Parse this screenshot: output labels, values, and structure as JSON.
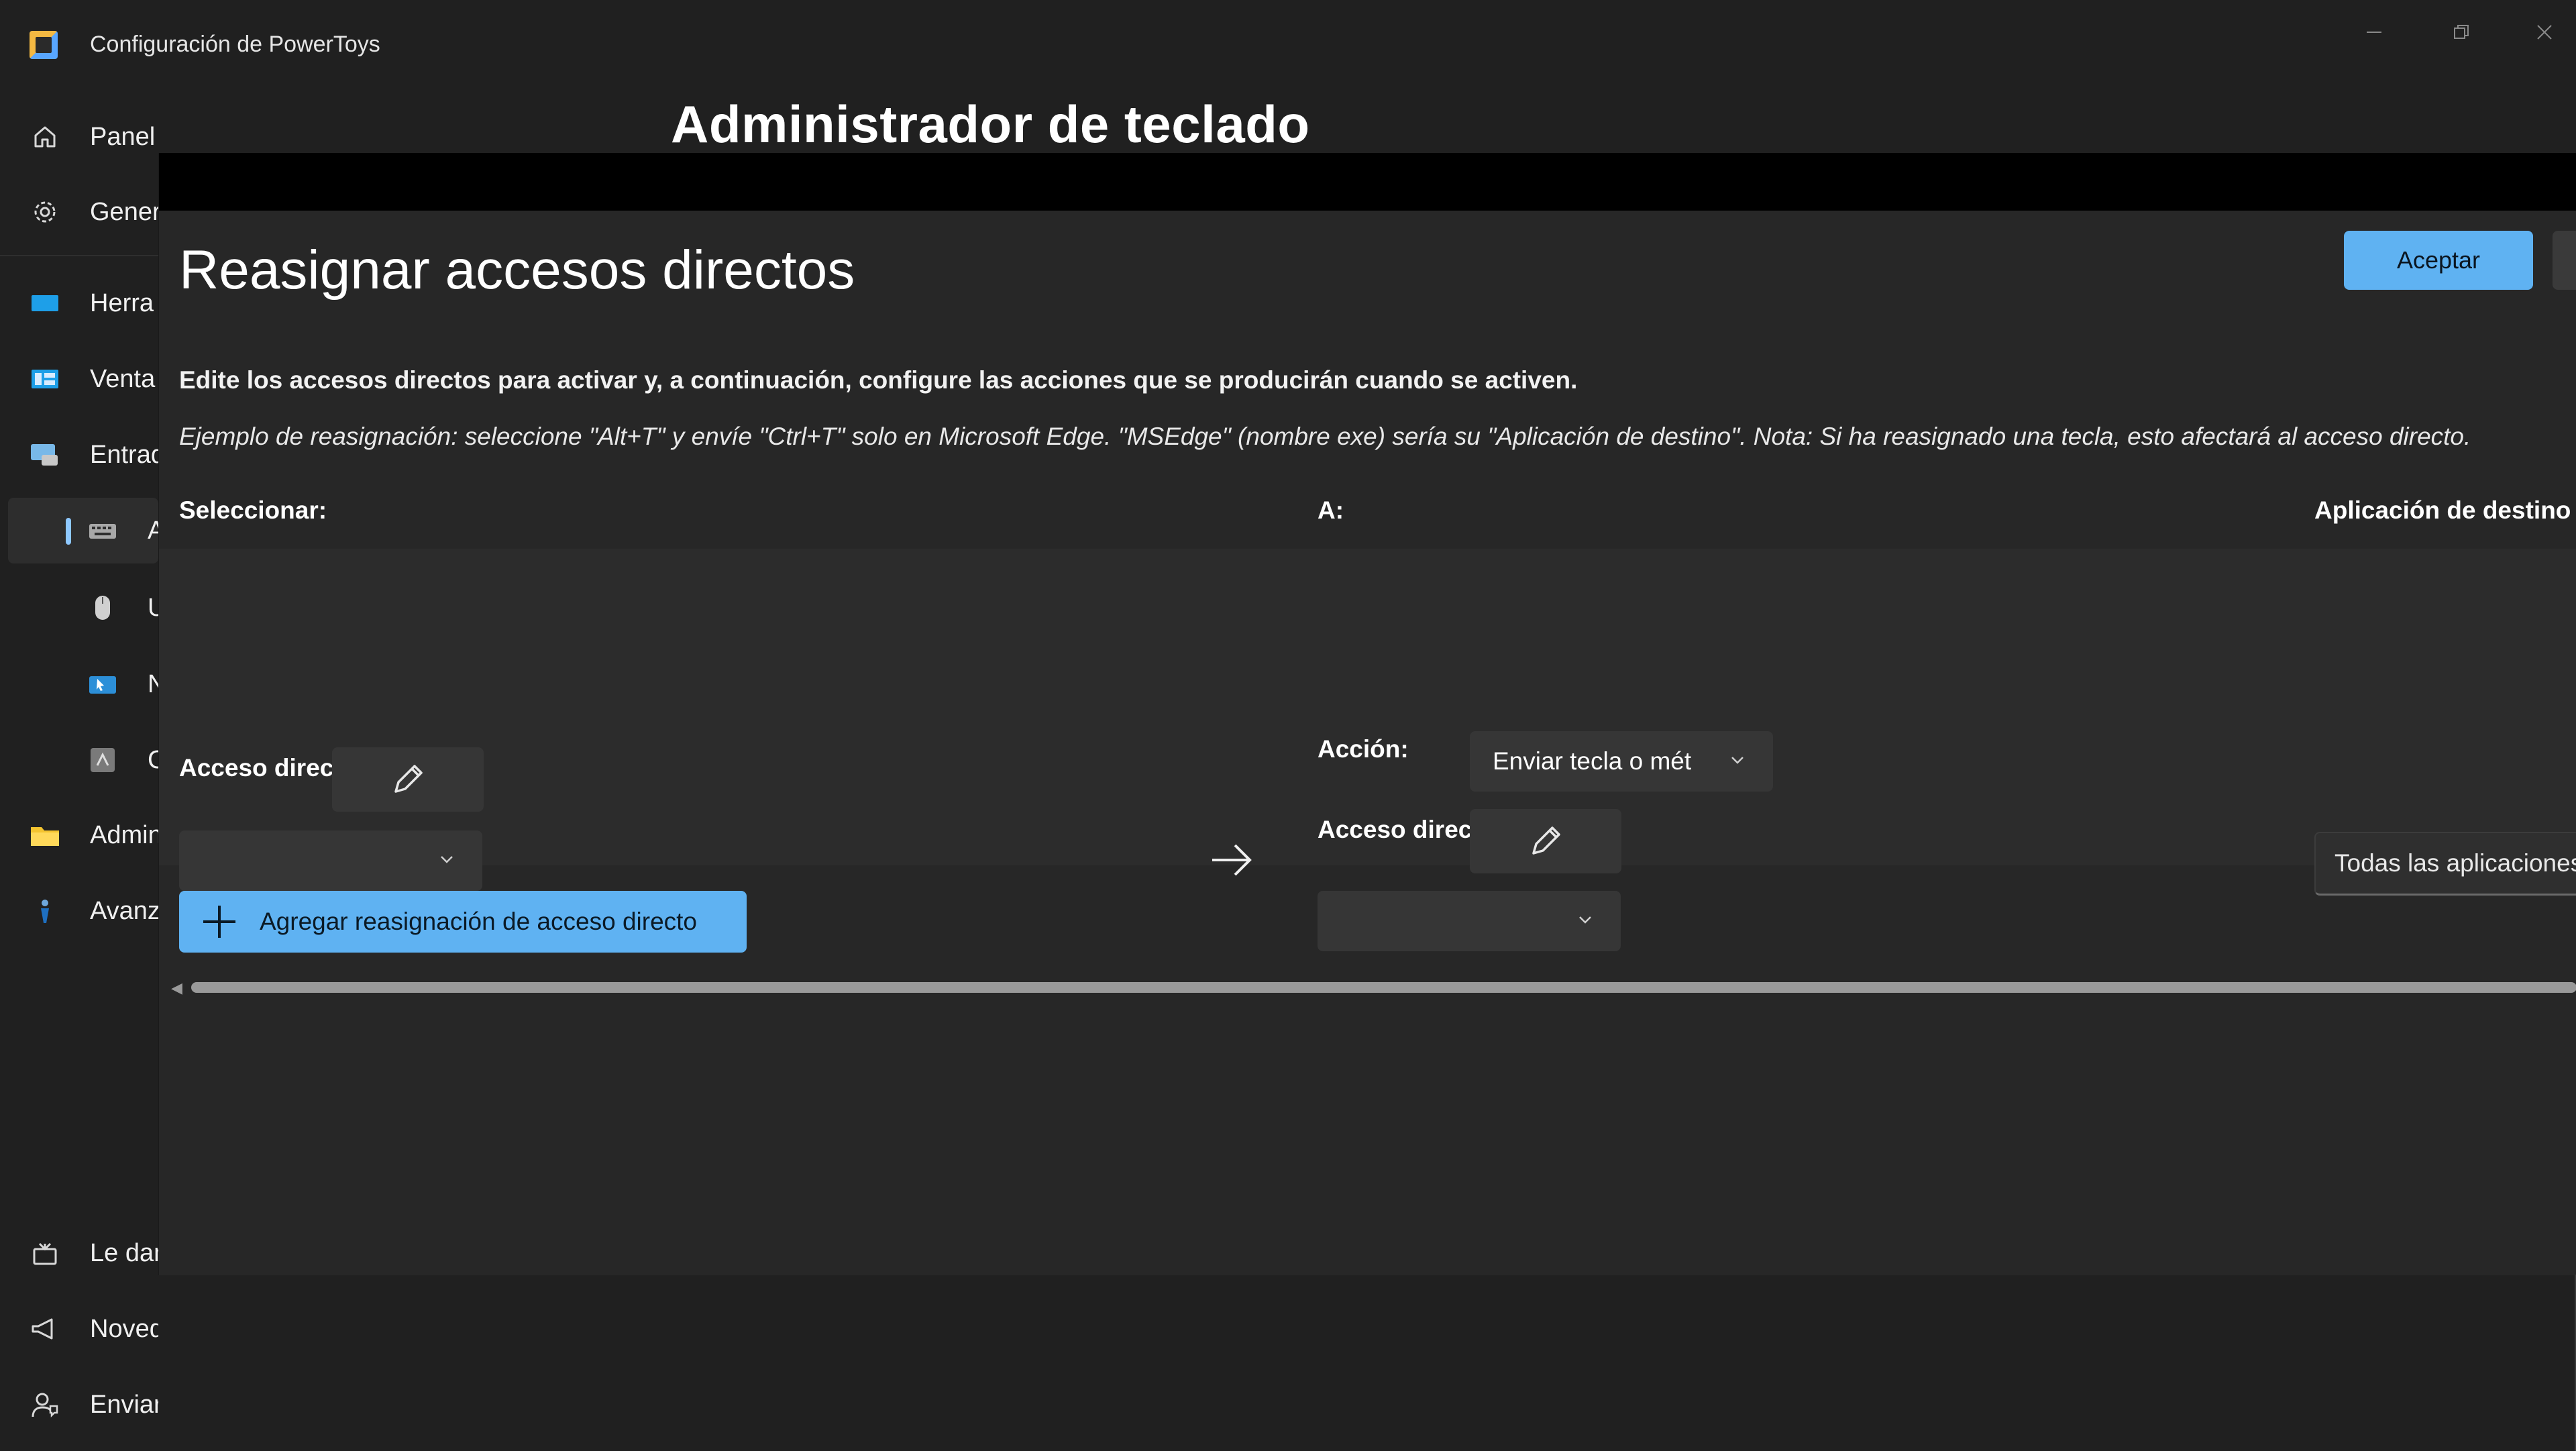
{
  "window": {
    "title": "Configuración de PowerToys",
    "controls": [
      "minimize-icon",
      "restore-icon",
      "close-icon"
    ]
  },
  "sidebar": {
    "items": [
      {
        "label": "Panel",
        "icon": "home-icon"
      },
      {
        "label": "Gener",
        "icon": "gear-icon"
      },
      {
        "label": "Herra",
        "icon": "monitor-icon"
      },
      {
        "label": "Venta",
        "icon": "windows-layout-icon"
      },
      {
        "label": "Entrad",
        "icon": "input-icon"
      },
      {
        "label": "A",
        "icon": "keyboard-icon",
        "selected": true
      },
      {
        "label": "U",
        "icon": "mouse-icon"
      },
      {
        "label": "N",
        "icon": "mouse-jump-icon"
      },
      {
        "label": "C",
        "icon": "crosshair-icon"
      },
      {
        "label": "Admin",
        "icon": "folder-icon"
      },
      {
        "label": "Avanz",
        "icon": "advanced-icon"
      }
    ],
    "footer": [
      {
        "label": "Le dan",
        "icon": "welcome-icon"
      },
      {
        "label": "Novedades",
        "icon": "megaphone-icon"
      },
      {
        "label": "Enviar comentarios",
        "icon": "feedback-icon"
      }
    ]
  },
  "page": {
    "title": "Administrador de teclado"
  },
  "dialog": {
    "title": "Reasignar accesos directos",
    "accept_label": "Aceptar",
    "description": "Edite los accesos directos para activar y, a continuación, configure las acciones que se producirán cuando se activen.",
    "example": "Ejemplo de reasignación: seleccione \"Alt+T\" y envíe \"Ctrl+T\" solo en Microsoft Edge. \"MSEdge\" (nombre exe) sería su \"Aplicación de destino\". Nota: Si ha reasignado una tecla, esto afectará al acceso directo.",
    "columns": {
      "select": "Seleccionar:",
      "to": "A:",
      "target_app": "Aplicación de destino"
    },
    "row": {
      "shortcut_label": "Acceso directo:",
      "action_label": "Acción:",
      "action_value": "Enviar tecla o mét",
      "target_shortcut_label": "Acceso directo:",
      "target_app_value": "Todas las aplicaciones"
    },
    "add_button_label": "Agregar reasignación de acceso directo"
  },
  "colors": {
    "accent": "#5fb2f2",
    "background": "#202020",
    "dialog": "#272727"
  }
}
